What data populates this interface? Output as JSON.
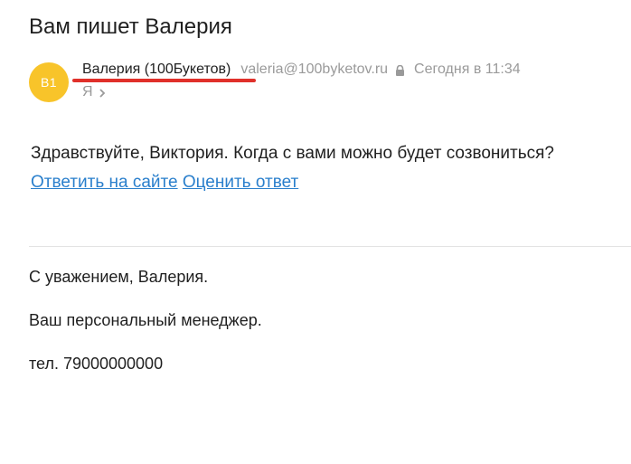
{
  "email": {
    "subject": "Вам пишет Валерия",
    "sender": {
      "avatar_initials": "В1",
      "avatar_color": "#f8c42a",
      "name": "Валерия (100Букетов)",
      "email": "valeria@100byketov.ru",
      "date": "Сегодня в 11:34"
    },
    "recipient": "Я",
    "body": {
      "greeting": "Здравствуйте, Виктория. Когда с вами можно будет созвониться?",
      "link_reply": "Ответить на сайте",
      "link_rate": "Оценить ответ"
    },
    "signature": {
      "line1": "С уважением, Валерия.",
      "line2": "Ваш персональный менеджер.",
      "line3": "тел. 79000000000"
    }
  },
  "colors": {
    "link": "#2a7fcc",
    "highlight_underline": "#e0302a",
    "muted_text": "#9a9a9a"
  }
}
